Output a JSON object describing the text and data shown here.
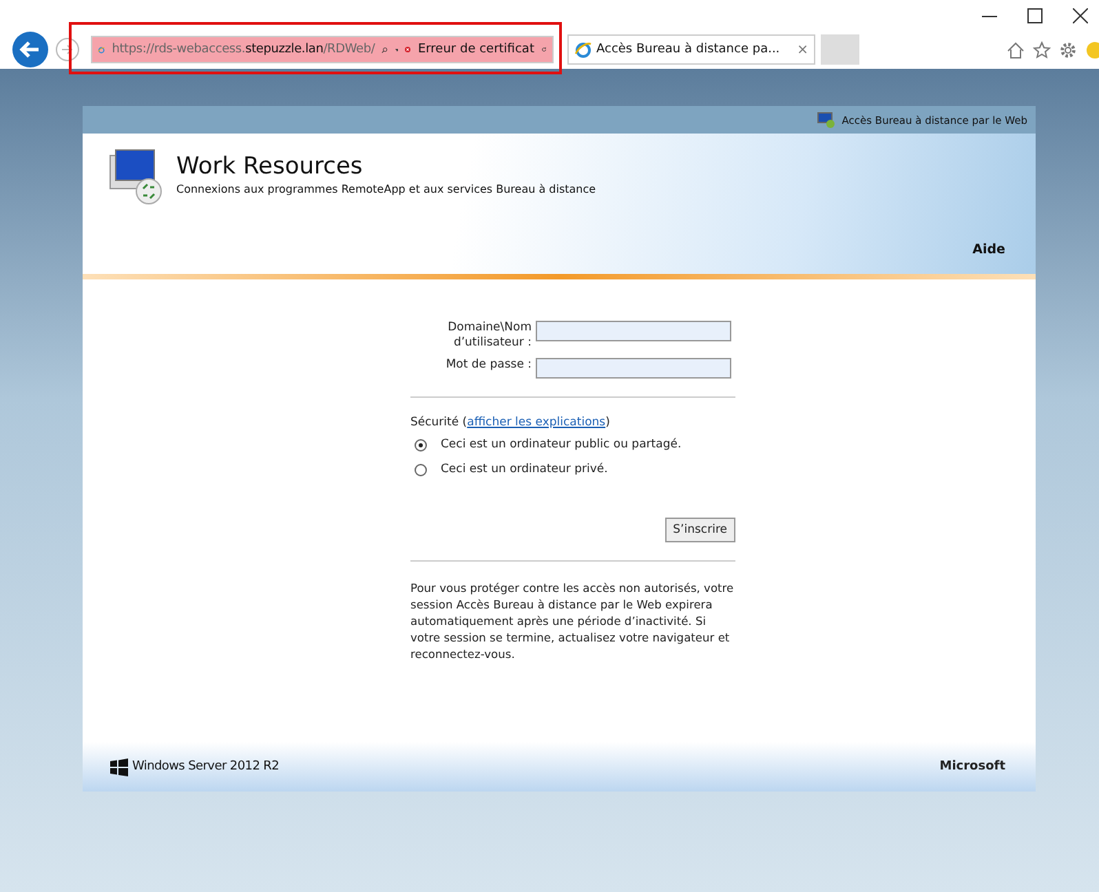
{
  "browser": {
    "address": {
      "prefix": "https://rds-webaccess.",
      "domain": "stepuzzle.lan",
      "path": "/RDWeb/",
      "certificate_error": "Erreur de certificat",
      "highlighted": true
    },
    "tabs": [
      {
        "label": "Accès Bureau à distance pa...",
        "close": "×",
        "selected": true
      }
    ]
  },
  "page": {
    "top_link": "Accès Bureau à distance par le Web",
    "title": "Work Resources",
    "subtitle": "Connexions aux programmes RemoteApp et aux services Bureau à distance",
    "help": "Aide",
    "form": {
      "fields": [
        {
          "label": "Domaine\\Nom d’utilisateur :"
        },
        {
          "label": "Mot de passe :"
        }
      ],
      "security_label": "Sécurité (",
      "security_link": "afficher les explications",
      "security_close": ")",
      "options": [
        {
          "label": "Ceci est un ordinateur public ou partagé.",
          "selected": true
        },
        {
          "label": "Ceci est un ordinateur privé.",
          "selected": false
        }
      ],
      "submit": "S’inscrire",
      "notice": "Pour vous protéger contre les accès non autorisés, votre session Accès Bureau à distance par le Web expirera automatiquement après une période d’inactivité. Si votre session se termine, actualisez votre navigateur et reconnectez-vous."
    },
    "footer": {
      "product": "Windows Server 2012 R2",
      "brand": "Microsoft"
    }
  }
}
